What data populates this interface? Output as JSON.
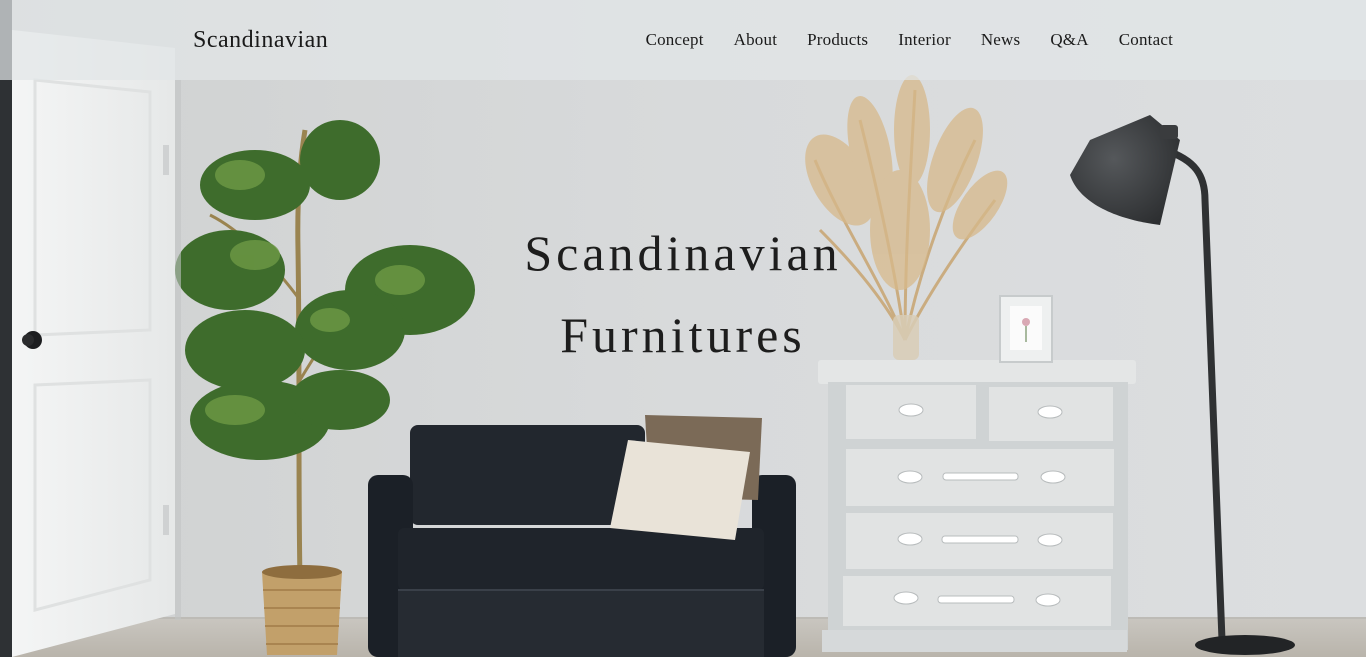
{
  "header": {
    "logo": "Scandinavian",
    "nav": [
      {
        "label": "Concept"
      },
      {
        "label": "About"
      },
      {
        "label": "Products"
      },
      {
        "label": "Interior"
      },
      {
        "label": "News"
      },
      {
        "label": "Q&A"
      },
      {
        "label": "Contact"
      }
    ]
  },
  "hero": {
    "title_line1": "Scandinavian",
    "title_line2": "Furnitures"
  },
  "colors": {
    "wall": "#d8dadb",
    "header_overlay": "#e2e6e7",
    "text": "#1b1b1b",
    "sofa": "#1f242c",
    "dresser": "#dcdfdf",
    "lamp": "#3a3c3e",
    "plant_leaf": "#3f6b2e",
    "basket": "#c2a06a"
  }
}
